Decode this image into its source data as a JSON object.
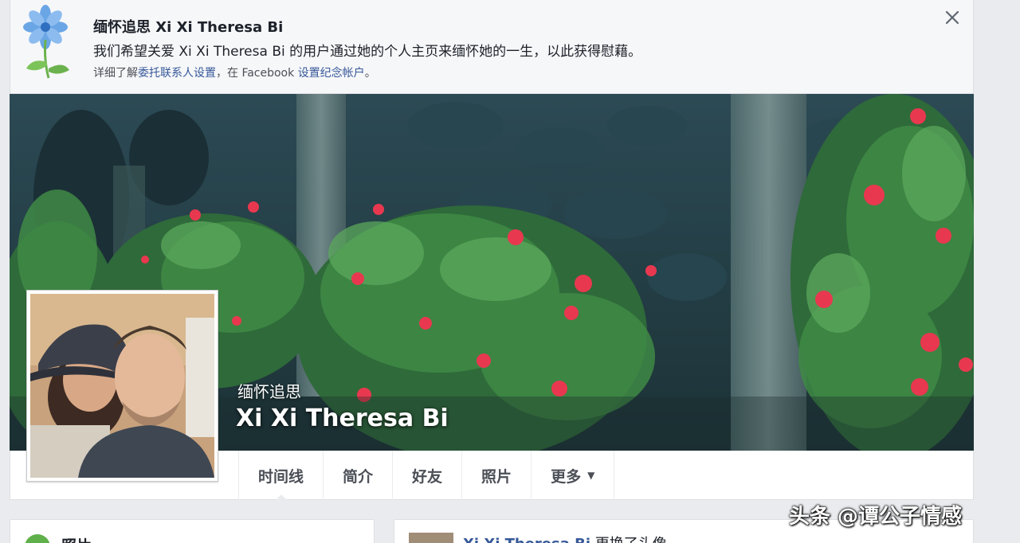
{
  "banner": {
    "title": "缅怀追思 Xi Xi Theresa Bi",
    "text": "我们希望关爱 Xi Xi Theresa Bi 的用户通过她的个人主页来缅怀她的一生，以此获得慰藉。",
    "sub_prefix": "详细了解",
    "sub_link1": "委托联系人设置",
    "sub_middle": "，在 Facebook ",
    "sub_link2": "设置纪念帐户",
    "sub_suffix": "。",
    "close_icon": "close-icon"
  },
  "profile": {
    "memorial_label": "缅怀追思",
    "name": "Xi Xi Theresa Bi"
  },
  "nav": {
    "tabs": [
      {
        "label": "时间线"
      },
      {
        "label": "简介"
      },
      {
        "label": "好友"
      },
      {
        "label": "照片"
      },
      {
        "label": "更多"
      }
    ],
    "more_caret": "▼"
  },
  "cards": {
    "left_label": "照片",
    "right_name": "Xi Xi Theresa Bi",
    "right_action": " 更换了头像"
  },
  "watermark": "头条 @谭公子情感",
  "colors": {
    "link": "#365899",
    "page_bg": "#e9ebee",
    "banner_bg": "#f6f7f9",
    "flower_blue": "#4a90d9",
    "leaf_green": "#5fb04a",
    "hibiscus_red": "#e8384f"
  }
}
